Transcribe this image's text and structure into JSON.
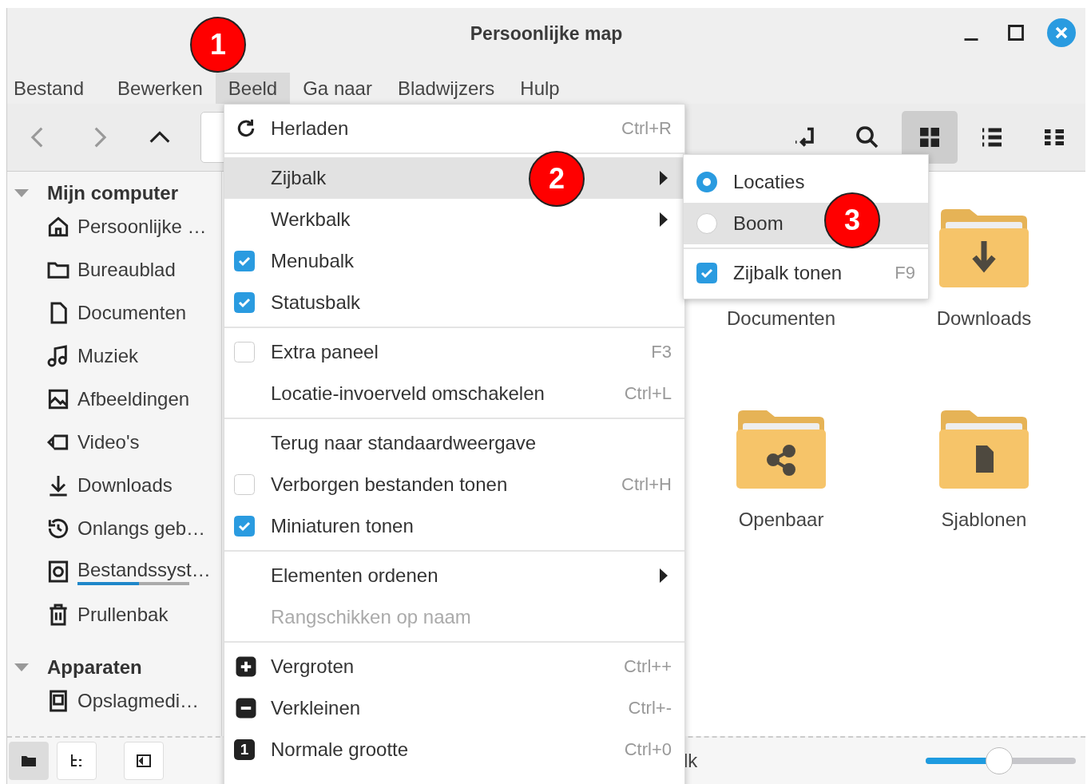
{
  "window": {
    "title": "Persoonlijke map"
  },
  "menubar": [
    {
      "label": "Bestand",
      "selected": false
    },
    {
      "label": "Bewerken",
      "selected": false
    },
    {
      "label": "Beeld",
      "selected": true
    },
    {
      "label": "Ga naar",
      "selected": false
    },
    {
      "label": "Bladwijzers",
      "selected": false
    },
    {
      "label": "Hulp",
      "selected": false
    }
  ],
  "toolbar": {
    "nav": [
      {
        "kind": "back",
        "disabled": true
      },
      {
        "kind": "forward",
        "disabled": true
      },
      {
        "kind": "up",
        "disabled": false
      }
    ],
    "tools": [
      {
        "kind": "location-toggle",
        "selected": false
      },
      {
        "kind": "search",
        "selected": false
      },
      {
        "kind": "grid",
        "selected": true
      },
      {
        "kind": "list",
        "selected": false
      },
      {
        "kind": "compact",
        "selected": false
      }
    ]
  },
  "sidebar": {
    "sections": [
      {
        "title": "Mijn computer",
        "expanded": true,
        "items": [
          {
            "label": "Persoonlijke …",
            "kind": "home"
          },
          {
            "label": "Bureaublad",
            "kind": "folder"
          },
          {
            "label": "Documenten",
            "kind": "document"
          },
          {
            "label": "Muziek",
            "kind": "music"
          },
          {
            "label": "Afbeeldingen",
            "kind": "image"
          },
          {
            "label": "Video's",
            "kind": "video"
          },
          {
            "label": "Downloads",
            "kind": "download"
          },
          {
            "label": "Onlangs geb…",
            "kind": "history"
          },
          {
            "label": "Bestandssyst…",
            "kind": "disk",
            "level": 0.55
          },
          {
            "label": "Prullenbak",
            "kind": "trash"
          }
        ]
      },
      {
        "title": "Apparaten",
        "expanded": true,
        "items": [
          {
            "label": "Opslagmedi…",
            "kind": "drive"
          }
        ]
      }
    ]
  },
  "files": [
    {
      "name": "Documenten",
      "kind": "hidden"
    },
    {
      "name": "Downloads",
      "kind": "download"
    },
    {
      "name": "Openbaar",
      "kind": "share"
    },
    {
      "name": "Sjablonen",
      "kind": "template"
    }
  ],
  "view_menu": {
    "groups": [
      [
        {
          "kind": "reload",
          "label": "Herladen",
          "shortcut": "Ctrl+R",
          "selected": false,
          "disabled": false
        }
      ],
      [
        {
          "kind": "submenu",
          "label": "Zijbalk",
          "selected": true,
          "disabled": false
        },
        {
          "kind": "submenu",
          "label": "Werkbalk",
          "selected": false,
          "disabled": false
        },
        {
          "kind": "check",
          "label": "Menubalk",
          "checked": true,
          "selected": false,
          "disabled": false
        },
        {
          "kind": "check",
          "label": "Statusbalk",
          "checked": true,
          "selected": false,
          "disabled": false
        }
      ],
      [
        {
          "kind": "check",
          "label": "Extra paneel",
          "checked": false,
          "shortcut": "F3",
          "selected": false,
          "disabled": false
        },
        {
          "kind": "plain",
          "label": "Locatie-invoerveld omschakelen",
          "shortcut": "Ctrl+L",
          "selected": false,
          "disabled": false
        }
      ],
      [
        {
          "kind": "plain",
          "label": "Terug naar standaardweergave",
          "selected": false,
          "disabled": false
        },
        {
          "kind": "check",
          "label": "Verborgen bestanden tonen",
          "checked": false,
          "shortcut": "Ctrl+H",
          "selected": false,
          "disabled": false
        },
        {
          "kind": "check",
          "label": "Miniaturen tonen",
          "checked": true,
          "selected": false,
          "disabled": false
        }
      ],
      [
        {
          "kind": "submenu",
          "label": "Elementen ordenen",
          "selected": false,
          "disabled": false
        },
        {
          "kind": "plain",
          "label": "Rangschikken op naam",
          "selected": false,
          "disabled": true
        }
      ],
      [
        {
          "kind": "plus",
          "label": "Vergroten",
          "shortcut": "Ctrl++",
          "selected": false,
          "disabled": false
        },
        {
          "kind": "minus",
          "label": "Verkleinen",
          "shortcut": "Ctrl+-",
          "selected": false,
          "disabled": false
        },
        {
          "kind": "digit",
          "icon_text": "1",
          "label": "Normale grootte",
          "shortcut": "Ctrl+0",
          "selected": false,
          "disabled": false
        }
      ]
    ]
  },
  "sidebar_submenu": {
    "groups": [
      [
        {
          "kind": "radio",
          "label": "Locaties",
          "checked": true,
          "selected": false
        },
        {
          "kind": "radio",
          "label": "Boom",
          "checked": false,
          "selected": true
        }
      ],
      [
        {
          "kind": "check",
          "label": "Zijbalk tonen",
          "checked": true,
          "shortcut": "F9",
          "selected": false
        }
      ]
    ]
  },
  "status_bar": {
    "panes": [
      {
        "kind": "places",
        "selected": true
      },
      {
        "kind": "tree",
        "selected": false
      },
      {
        "kind": "panel-toggle",
        "selected": false
      }
    ],
    "text": "lk",
    "zoom": {
      "level": 0.49
    }
  },
  "callouts": [
    {
      "number": "1"
    },
    {
      "number": "2"
    },
    {
      "number": "3"
    }
  ]
}
